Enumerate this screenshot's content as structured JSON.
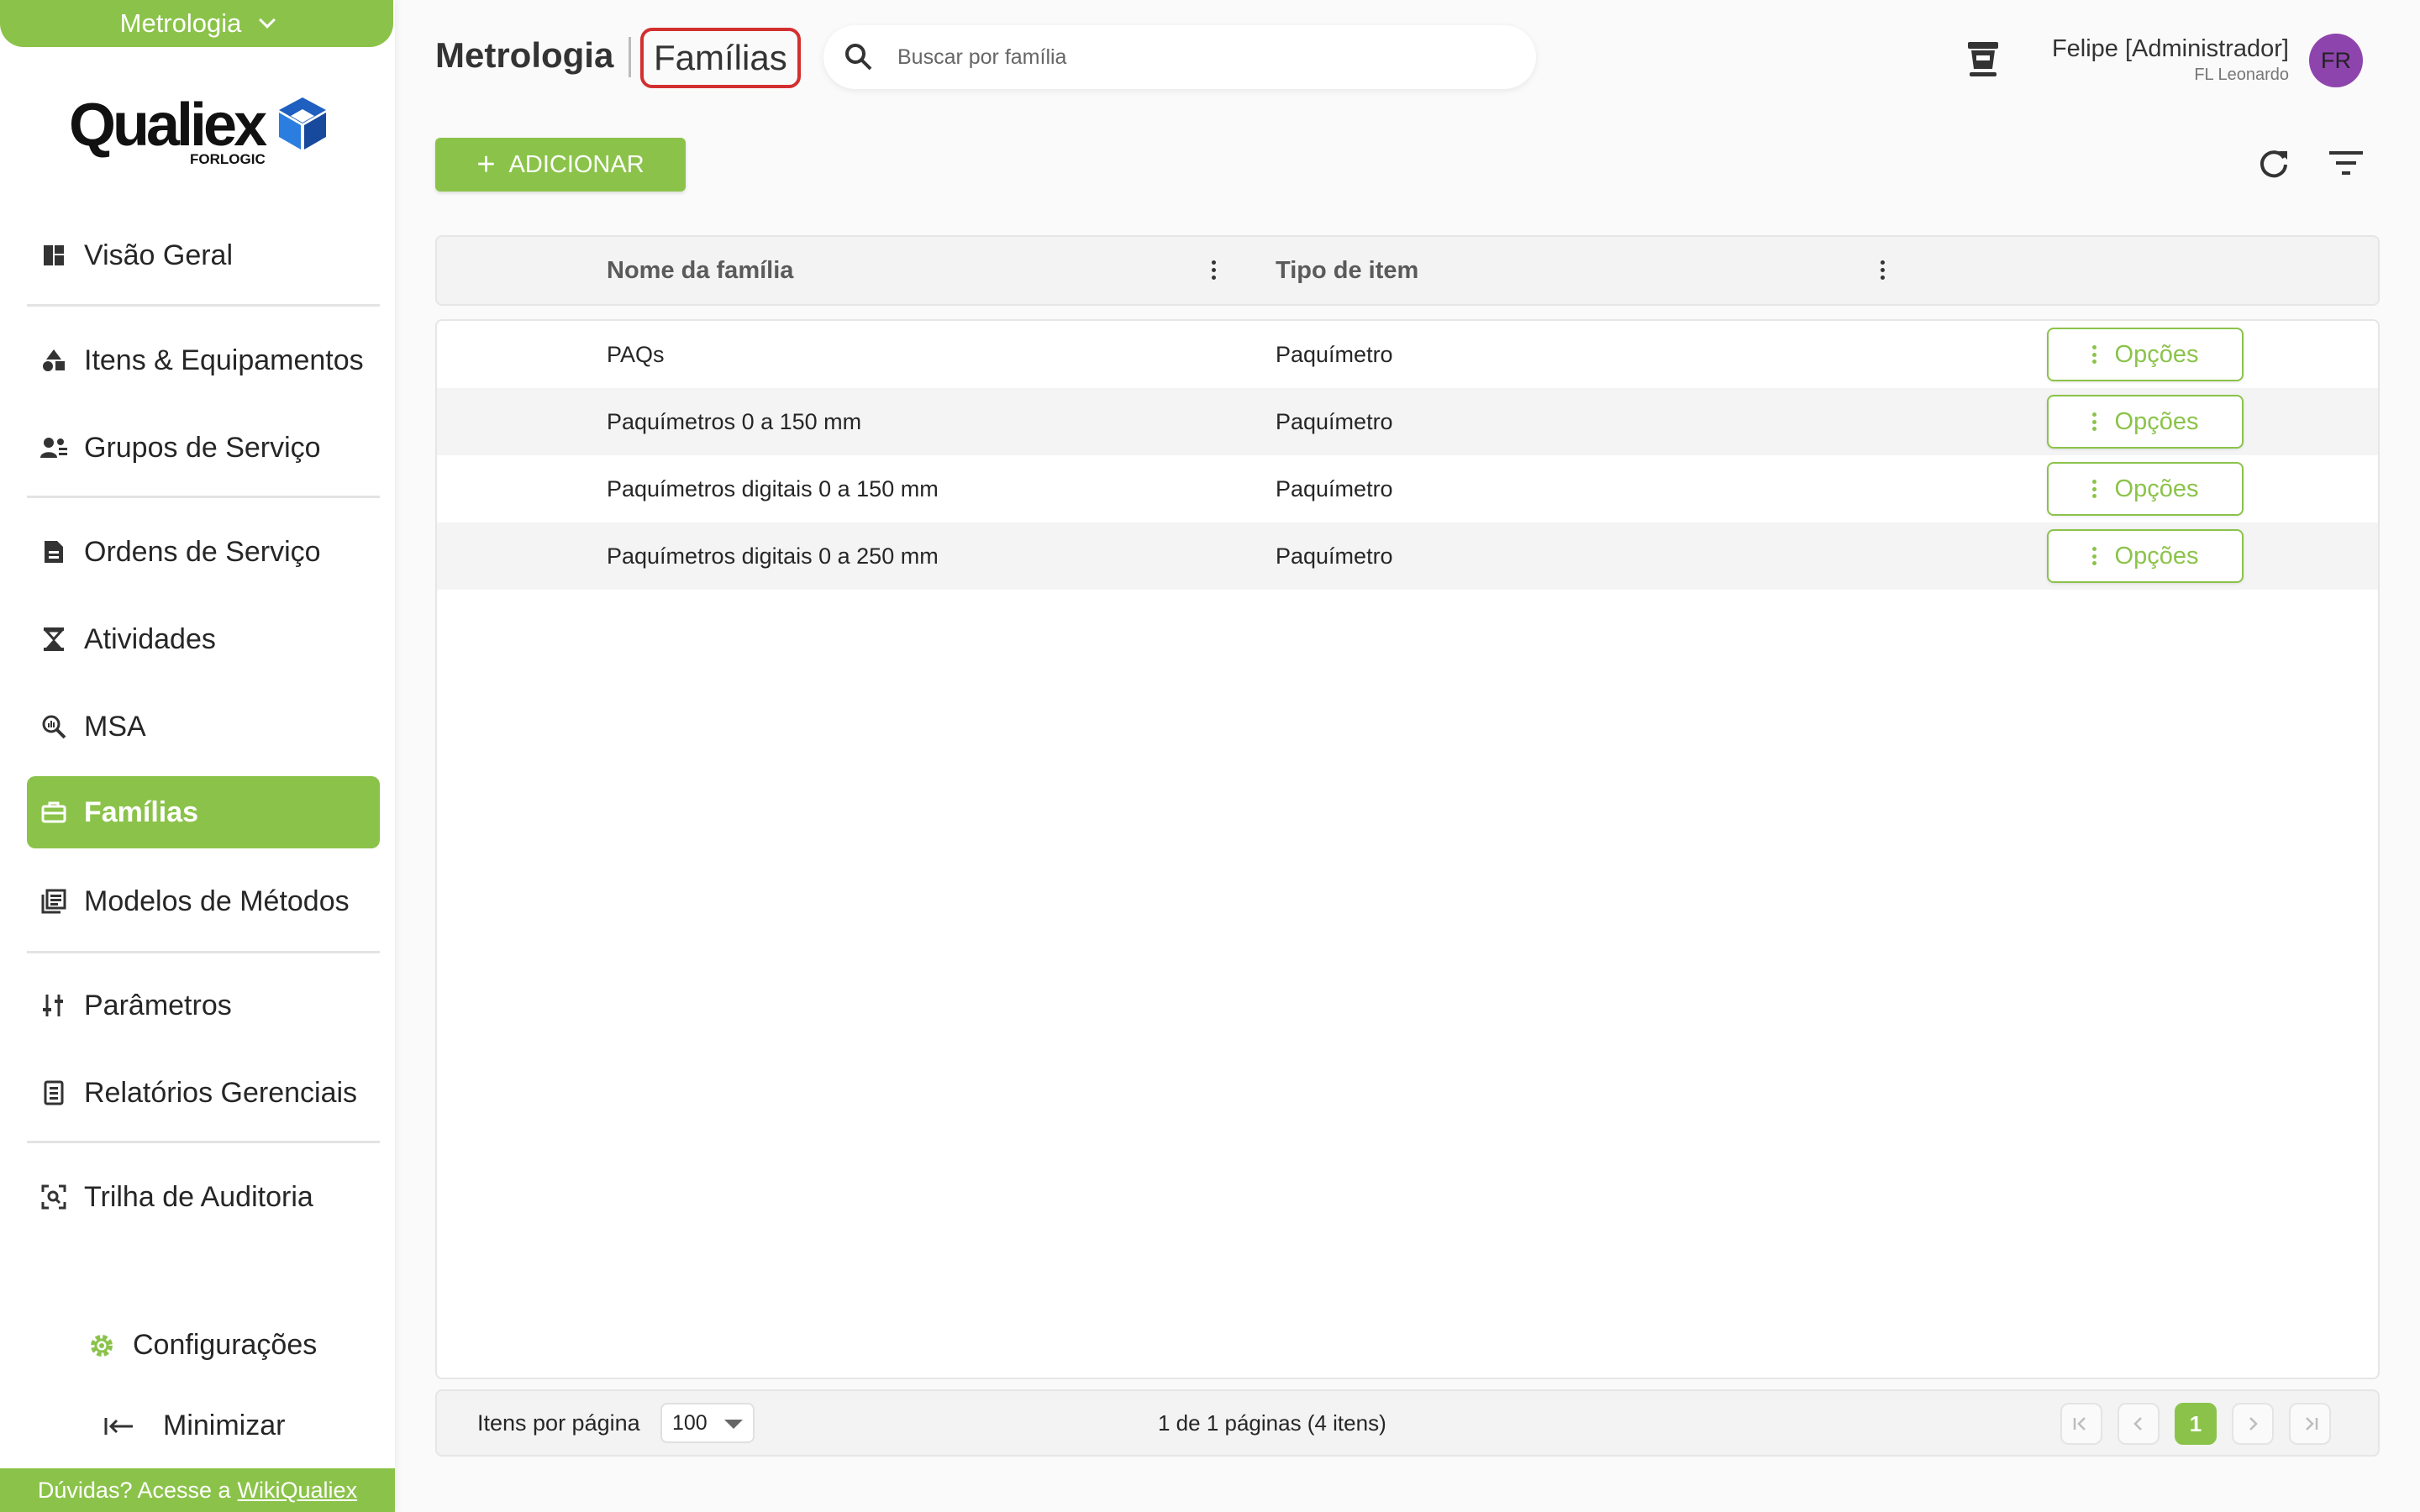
{
  "app": {
    "module": "Metrologia",
    "logo_word": "Qualiex",
    "logo_sub": "FORLOGIC"
  },
  "sidebar": {
    "items": [
      {
        "label": "Visão Geral",
        "icon": "dashboard-icon"
      },
      {
        "label": "Itens & Equipamentos",
        "icon": "shapes-icon"
      },
      {
        "label": "Grupos de Serviço",
        "icon": "group-icon"
      },
      {
        "label": "Ordens de Serviço",
        "icon": "document-icon"
      },
      {
        "label": "Atividades",
        "icon": "hourglass-icon"
      },
      {
        "label": "MSA",
        "icon": "zoom-analysis-icon"
      },
      {
        "label": "Famílias",
        "icon": "toolbox-icon"
      },
      {
        "label": "Modelos de Métodos",
        "icon": "library-icon"
      },
      {
        "label": "Parâmetros",
        "icon": "sliders-icon"
      },
      {
        "label": "Relatórios Gerenciais",
        "icon": "report-icon"
      },
      {
        "label": "Trilha de Auditoria",
        "icon": "audit-scan-icon"
      }
    ],
    "active": "Famílias",
    "config_label": "Configurações",
    "minimize_label": "Minimizar",
    "help_text": "Dúvidas? Acesse a",
    "help_link": "WikiQualiex"
  },
  "header": {
    "breadcrumb_root": "Metrologia",
    "breadcrumb_current": "Famílias",
    "search_placeholder": "Buscar por família",
    "user_name": "Felipe [Administrador]",
    "user_org": "FL Leonardo",
    "avatar_initials": "FR"
  },
  "toolbar": {
    "add_label": "ADICIONAR"
  },
  "table": {
    "columns": [
      "Nome da família",
      "Tipo de item"
    ],
    "rows": [
      {
        "name": "PAQs",
        "type": "Paquímetro",
        "action": "Opções"
      },
      {
        "name": "Paquímetros 0 a 150 mm",
        "type": "Paquímetro",
        "action": "Opções"
      },
      {
        "name": "Paquímetros digitais 0 a 150 mm",
        "type": "Paquímetro",
        "action": "Opções"
      },
      {
        "name": "Paquímetros digitais 0 a 250 mm",
        "type": "Paquímetro",
        "action": "Opções"
      }
    ]
  },
  "pager": {
    "per_page_label": "Itens por página",
    "per_page_value": "100",
    "info": "1 de 1 páginas (4 itens)",
    "current_page": "1"
  },
  "colors": {
    "accent": "#8bc34a",
    "highlight": "#d32f2f",
    "avatar": "#8e44ad"
  }
}
